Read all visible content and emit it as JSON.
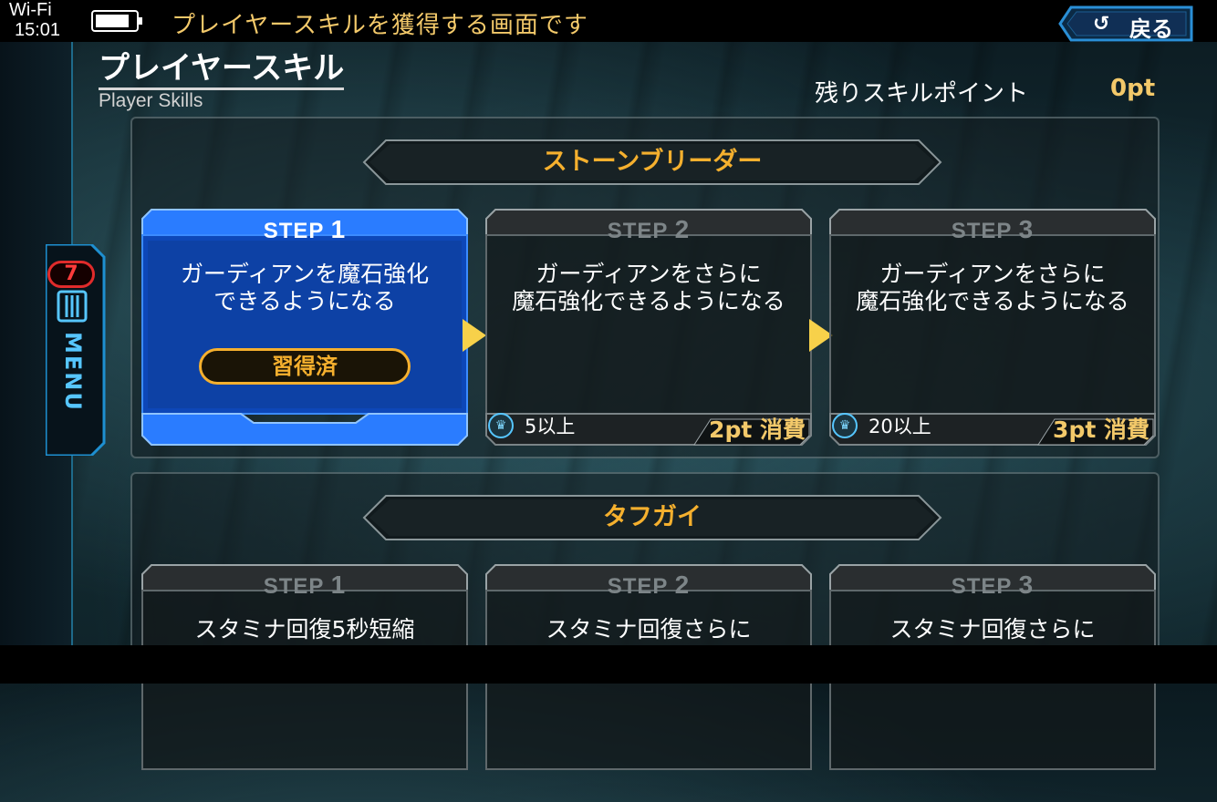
{
  "status_bar": {
    "network": "Wi-Fi",
    "time": "15:01"
  },
  "header": {
    "help_text": "プレイヤースキルを獲得する画面です",
    "back_label": "戻る",
    "back_icon": "undo-arrow-icon"
  },
  "side_menu": {
    "badge_count": "7",
    "label": "MENU",
    "icon": "menu-lines-icon"
  },
  "page": {
    "title": "プレイヤースキル",
    "subtitle": "Player Skills",
    "points_label": "残りスキルポイント",
    "points_value": "0pt"
  },
  "skill_groups": [
    {
      "name": "ストーンブリーダー",
      "steps": [
        {
          "step": "STEP",
          "num": "1",
          "description": "ガーディアンを魔石強化\nできるようになる",
          "status": "習得済",
          "state": "acquired"
        },
        {
          "step": "STEP",
          "num": "2",
          "description": "ガーディアンをさらに\n魔石強化できるようになる",
          "requirement": "5以上",
          "cost": "2pt 消費",
          "state": "locked"
        },
        {
          "step": "STEP",
          "num": "3",
          "description": "ガーディアンをさらに\n魔石強化できるようになる",
          "requirement": "20以上",
          "cost": "3pt 消費",
          "state": "locked"
        }
      ]
    },
    {
      "name": "タフガイ",
      "steps": [
        {
          "step": "STEP",
          "num": "1",
          "description": "スタミナ回復5秒短縮",
          "state": "locked"
        },
        {
          "step": "STEP",
          "num": "2",
          "description": "スタミナ回復さらに",
          "state": "locked"
        },
        {
          "step": "STEP",
          "num": "3",
          "description": "スタミナ回復さらに",
          "state": "locked"
        }
      ]
    }
  ],
  "colors": {
    "accent_gold": "#f5b02e",
    "active_blue": "#1e6bff",
    "menu_blue": "#56c6ff",
    "badge_red": "#e02b2b"
  }
}
